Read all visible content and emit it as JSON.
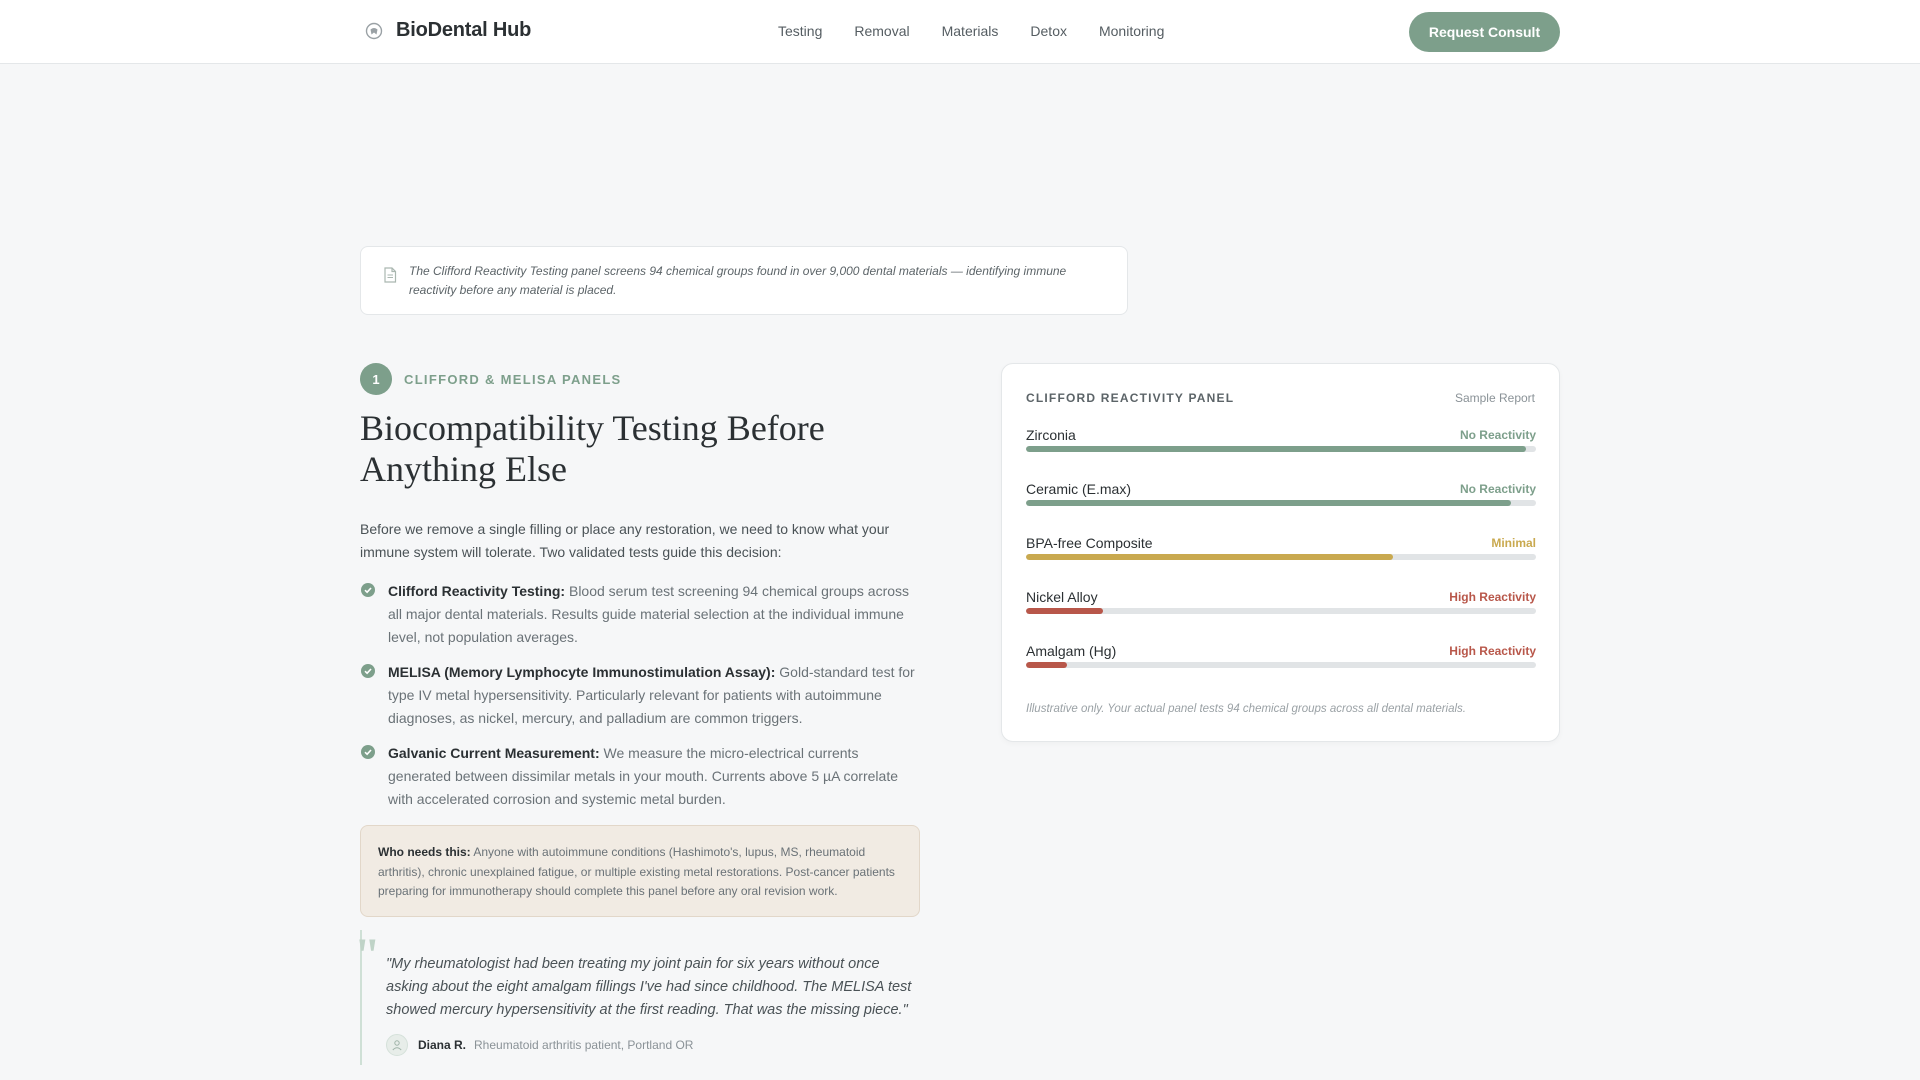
{
  "header": {
    "brand": "BioDental Hub",
    "nav": [
      "Testing",
      "Removal",
      "Materials",
      "Detox",
      "Monitoring"
    ],
    "cta": "Request Consult"
  },
  "note": {
    "text": "The Clifford Reactivity Testing panel screens 94 chemical groups found in over 9,000 dental materials — identifying immune reactivity before any material is placed.",
    "icon": "document-icon"
  },
  "section": {
    "step_number": "1",
    "step_label": "CLIFFORD & MELISA PANELS",
    "title": "Biocompatibility Testing Before Anything Else",
    "intro": "Before we remove a single filling or place any restoration, we need to know what your immune system will tolerate. Two validated tests guide this decision:",
    "items": [
      {
        "title": "Clifford Reactivity Testing:",
        "text": " Blood serum test screening 94 chemical groups across all major dental materials. Results guide material selection at the individual immune level, not population averages."
      },
      {
        "title": "MELISA (Memory Lymphocyte Immunostimulation Assay):",
        "text": " Gold-standard test for type IV metal hypersensitivity. Particularly relevant for patients with autoimmune diagnoses, as nickel, mercury, and palladium are common triggers."
      },
      {
        "title": "Galvanic Current Measurement:",
        "text": " We measure the micro-electrical currents generated between dissimilar metals in your mouth. Currents above 5 µA correlate with accelerated corrosion and systemic metal burden."
      }
    ],
    "who": {
      "label": "Who needs this:",
      "text": " Anyone with autoimmune conditions (Hashimoto's, lupus, MS, rheumatoid arthritis), chronic unexplained fatigue, or multiple existing metal restorations. Post-cancer patients preparing for immunotherapy should complete this panel before any oral revision work."
    },
    "quote": {
      "text": "\"My rheumatologist had been treating my joint pain for six years without once asking about the eight amalgam fillings I've had since childhood. The MELISA test showed mercury hypersensitivity at the first reading. That was the missing piece.\"",
      "author": "Diana R.",
      "role": "Rheumatoid arthritis patient, Portland OR"
    }
  },
  "panel": {
    "title": "CLIFFORD REACTIVITY PANEL",
    "sample": "Sample Report",
    "rows": [
      {
        "name": "Zirconia",
        "status": "No Reactivity",
        "level": 98,
        "color": "#7d9f8b"
      },
      {
        "name": "Ceramic (E.max)",
        "status": "No Reactivity",
        "level": 95,
        "color": "#7d9f8b"
      },
      {
        "name": "BPA-free Composite",
        "status": "Minimal",
        "level": 72,
        "color": "#c9a94f"
      },
      {
        "name": "Nickel Alloy",
        "status": "High Reactivity",
        "level": 15,
        "color": "#b8574a"
      },
      {
        "name": "Amalgam (Hg)",
        "status": "High Reactivity",
        "level": 8,
        "color": "#b8574a"
      }
    ],
    "footnote": "Illustrative only. Your actual panel tests 94 chemical groups across all dental materials."
  },
  "colors": {
    "accent": "#7d9f8b",
    "warning": "#c9a94f",
    "danger": "#b8574a"
  }
}
